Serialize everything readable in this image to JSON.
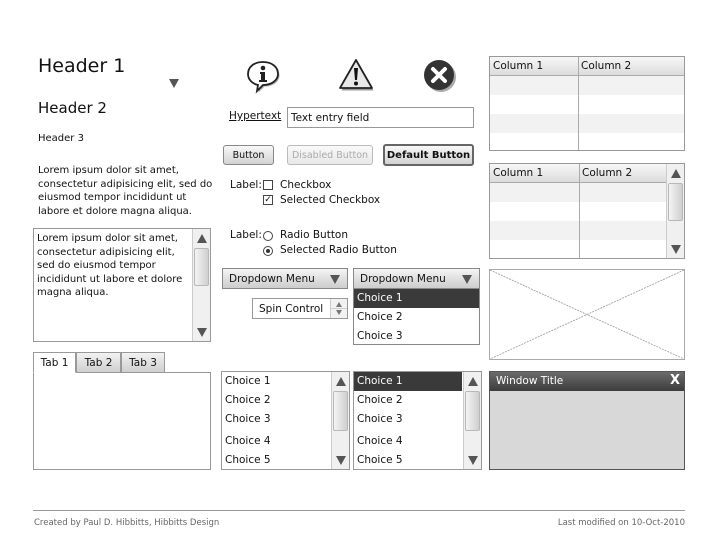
{
  "headers": {
    "h1": "Header 1",
    "h2": "Header 2",
    "h3": "Header 3"
  },
  "paragraph": "Lorem ipsum dolor sit amet, consectetur adipisicing elit, sed do eiusmod tempor incididunt ut labore et dolore magna aliqua.",
  "textarea": {
    "text": "Lorem ipsum dolor sit amet, consectetur adipisicing elit, sed do eiusmod tempor incididunt ut labore et dolore magna aliqua."
  },
  "tabs": [
    {
      "label": "Tab 1",
      "active": true
    },
    {
      "label": "Tab 2",
      "active": false
    },
    {
      "label": "Tab 3",
      "active": false
    }
  ],
  "icons": {
    "info": "info-icon",
    "warning": "warning-icon",
    "error": "error-icon"
  },
  "hypertext": "Hypertext",
  "text_field": {
    "value": "Text entry field"
  },
  "buttons": {
    "normal": "Button",
    "disabled": "Disabled Button",
    "default": "Default Button"
  },
  "checkboxes": {
    "label": "Label:",
    "items": [
      {
        "label": "Checkbox",
        "checked": false
      },
      {
        "label": "Selected Checkbox",
        "checked": true
      }
    ]
  },
  "radios": {
    "label": "Label:",
    "items": [
      {
        "label": "Radio Button",
        "selected": false
      },
      {
        "label": "Selected Radio Button",
        "selected": true
      }
    ]
  },
  "dropdown_closed": {
    "value": "Dropdown Menu"
  },
  "dropdown_open": {
    "value": "Dropdown Menu",
    "options": [
      "Choice 1",
      "Choice 2",
      "Choice 3"
    ],
    "selected_index": 0
  },
  "spin_control": {
    "value": "Spin Control"
  },
  "listbox_1": {
    "items": [
      "Choice 1",
      "Choice 2",
      "Choice 3",
      "Choice 4",
      "Choice 5"
    ],
    "selected_index": null
  },
  "listbox_2": {
    "items": [
      "Choice 1",
      "Choice 2",
      "Choice 3",
      "Choice 4",
      "Choice 5"
    ],
    "selected_index": 0
  },
  "table_1": {
    "columns": [
      "Column 1",
      "Column 2"
    ],
    "rows": [
      [
        "",
        ""
      ],
      [
        "",
        ""
      ],
      [
        "",
        ""
      ],
      [
        "",
        ""
      ]
    ]
  },
  "table_2": {
    "columns": [
      "Column 1",
      "Column 2"
    ],
    "rows": [
      [
        "",
        ""
      ],
      [
        "",
        ""
      ],
      [
        "",
        ""
      ],
      [
        "",
        ""
      ]
    ]
  },
  "window": {
    "title": "Window Title",
    "close_label": "X"
  },
  "footer": {
    "left": "Created by Paul D. Hibbitts, Hibbitts Design",
    "right": "Last modified on 10-Oct-2010"
  },
  "colors": {
    "selection": "#3a3a3a",
    "window_titlebar": "#4a4a4a",
    "window_body": "#d8d8d8",
    "border": "#999999"
  }
}
